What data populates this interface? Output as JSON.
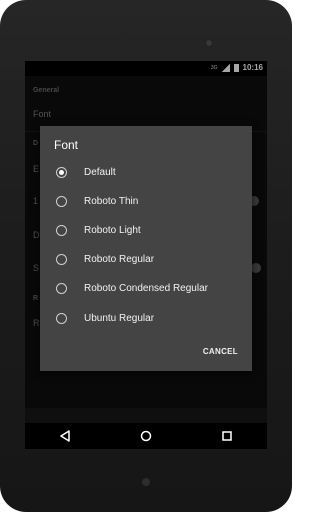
{
  "status_bar": {
    "network": "3G",
    "time": "10:16"
  },
  "settings_bg": {
    "section_general": "General",
    "font_item": "Font",
    "partial_items": [
      "D",
      "E",
      "1",
      "D",
      "S",
      "R",
      "R"
    ]
  },
  "dialog": {
    "title": "Font",
    "selected_index": 0,
    "options": [
      {
        "label": "Default"
      },
      {
        "label": "Roboto Thin"
      },
      {
        "label": "Roboto Light"
      },
      {
        "label": "Roboto Regular"
      },
      {
        "label": "Roboto Condensed Regular"
      },
      {
        "label": "Ubuntu Regular"
      }
    ],
    "cancel_label": "CANCEL"
  },
  "nav_bar": {
    "back": "back-icon",
    "home": "home-icon",
    "recents": "recents-icon"
  }
}
